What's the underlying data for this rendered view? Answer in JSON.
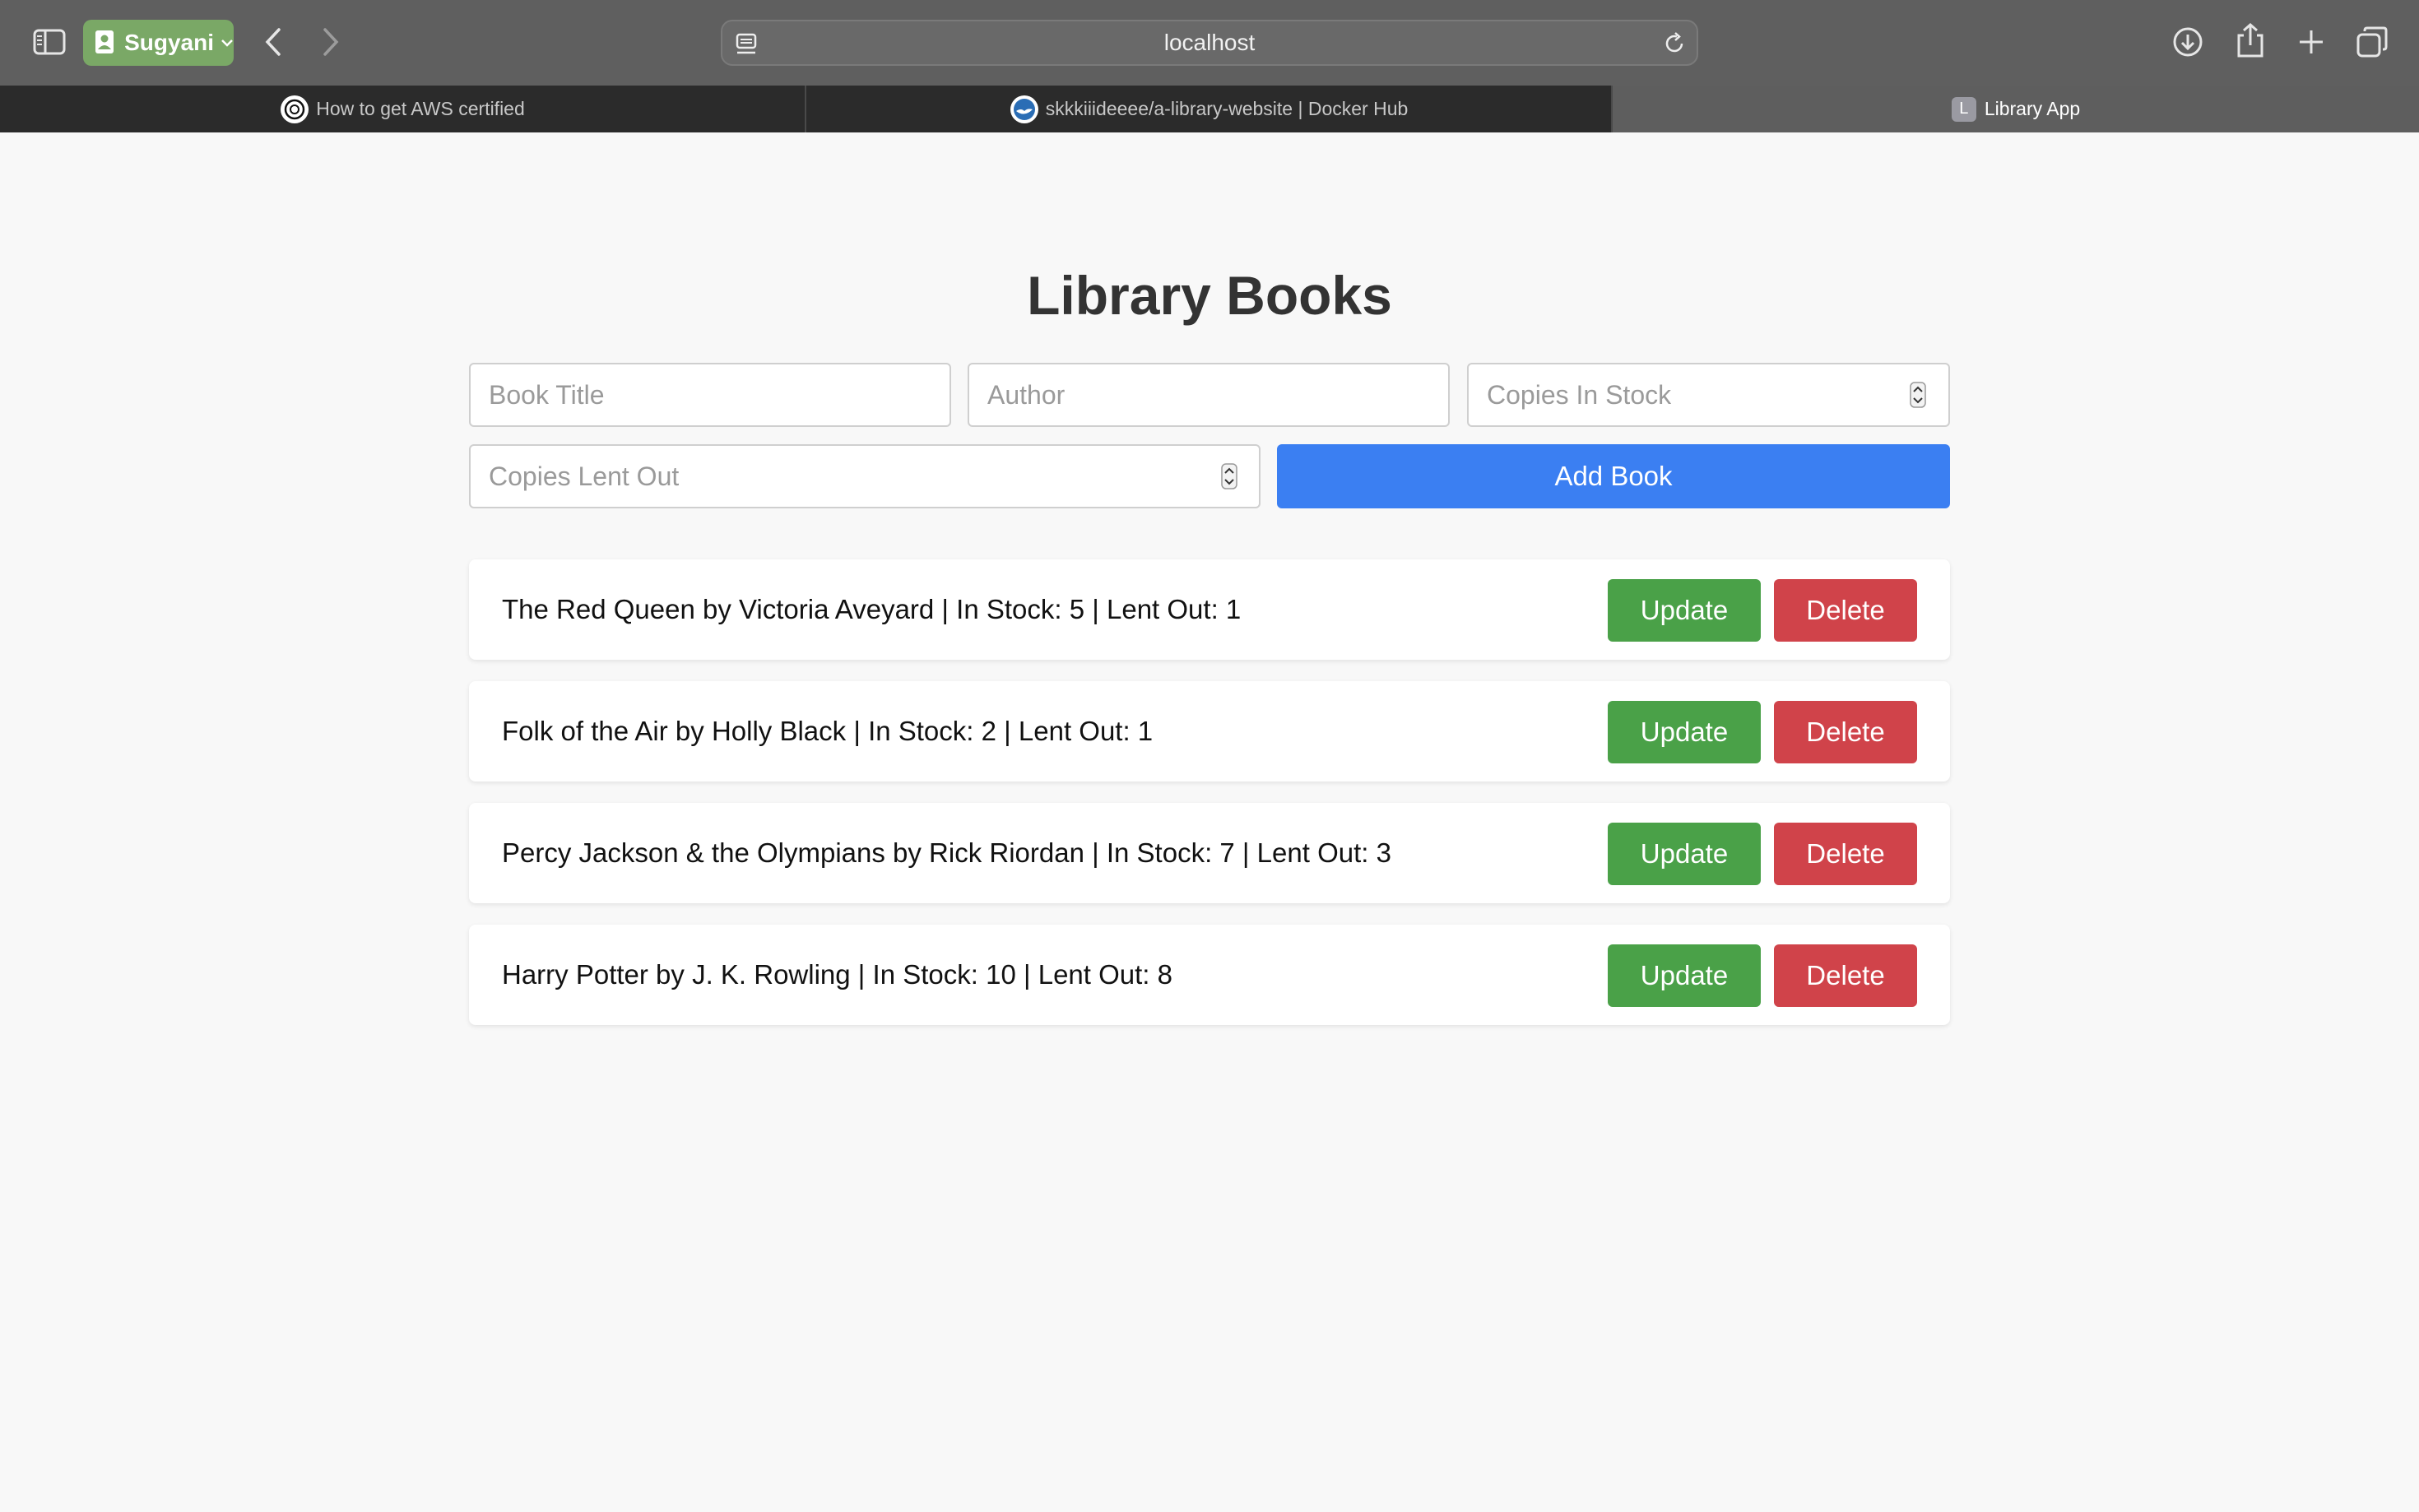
{
  "browser": {
    "profile_name": "Sugyani",
    "address": "localhost",
    "tabs": [
      {
        "label": "How to get AWS certified",
        "active": false
      },
      {
        "label": "skkkiiideeee/a-library-website | Docker Hub",
        "active": false
      },
      {
        "label": "Library App",
        "active": true,
        "favicon_letter": "L"
      }
    ]
  },
  "page": {
    "title": "Library Books",
    "form": {
      "title_placeholder": "Book Title",
      "author_placeholder": "Author",
      "stock_placeholder": "Copies In Stock",
      "lent_placeholder": "Copies Lent Out",
      "add_label": "Add Book"
    },
    "books": [
      {
        "text": "The Red Queen by Victoria Aveyard | In Stock: 5 | Lent Out: 1",
        "update_label": "Update",
        "delete_label": "Delete"
      },
      {
        "text": "Folk of the Air by Holly Black | In Stock: 2 | Lent Out: 1",
        "update_label": "Update",
        "delete_label": "Delete"
      },
      {
        "text": "Percy Jackson & the Olympians by Rick Riordan | In Stock: 7 | Lent Out: 3",
        "update_label": "Update",
        "delete_label": "Delete"
      },
      {
        "text": "Harry Potter by J. K. Rowling | In Stock: 10 | Lent Out: 8",
        "update_label": "Update",
        "delete_label": "Delete"
      }
    ]
  },
  "colors": {
    "primary": "#3b7ff2",
    "update": "#4aa148",
    "delete": "#d0434a",
    "profile": "#7aa866"
  }
}
